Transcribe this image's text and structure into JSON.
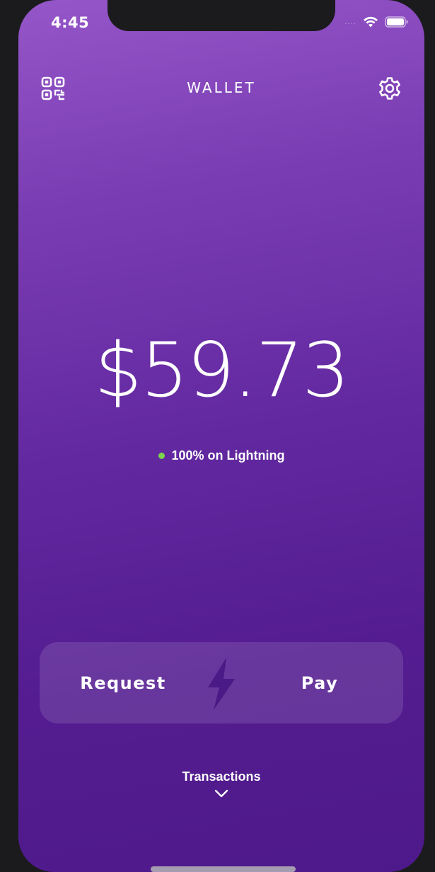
{
  "status_bar": {
    "time": "4:45",
    "signal": "....",
    "wifi_icon": "wifi-icon",
    "battery_icon": "battery-icon"
  },
  "header": {
    "title": "WALLET",
    "left_icon": "qr-code-icon",
    "right_icon": "gear-icon"
  },
  "balance": {
    "amount": "$59.73"
  },
  "channel_status": {
    "text": "100% on Lightning",
    "dot_color": "#7cd54a"
  },
  "actions": {
    "request_label": "Request",
    "pay_label": "Pay",
    "center_icon": "lightning-bolt-icon"
  },
  "transactions": {
    "label": "Transactions",
    "icon": "chevron-down-icon"
  },
  "colors": {
    "gradient_top": "#9456c8",
    "gradient_bottom": "#4e1a8b",
    "text": "#ffffff",
    "bolt": "#4a1a86"
  }
}
